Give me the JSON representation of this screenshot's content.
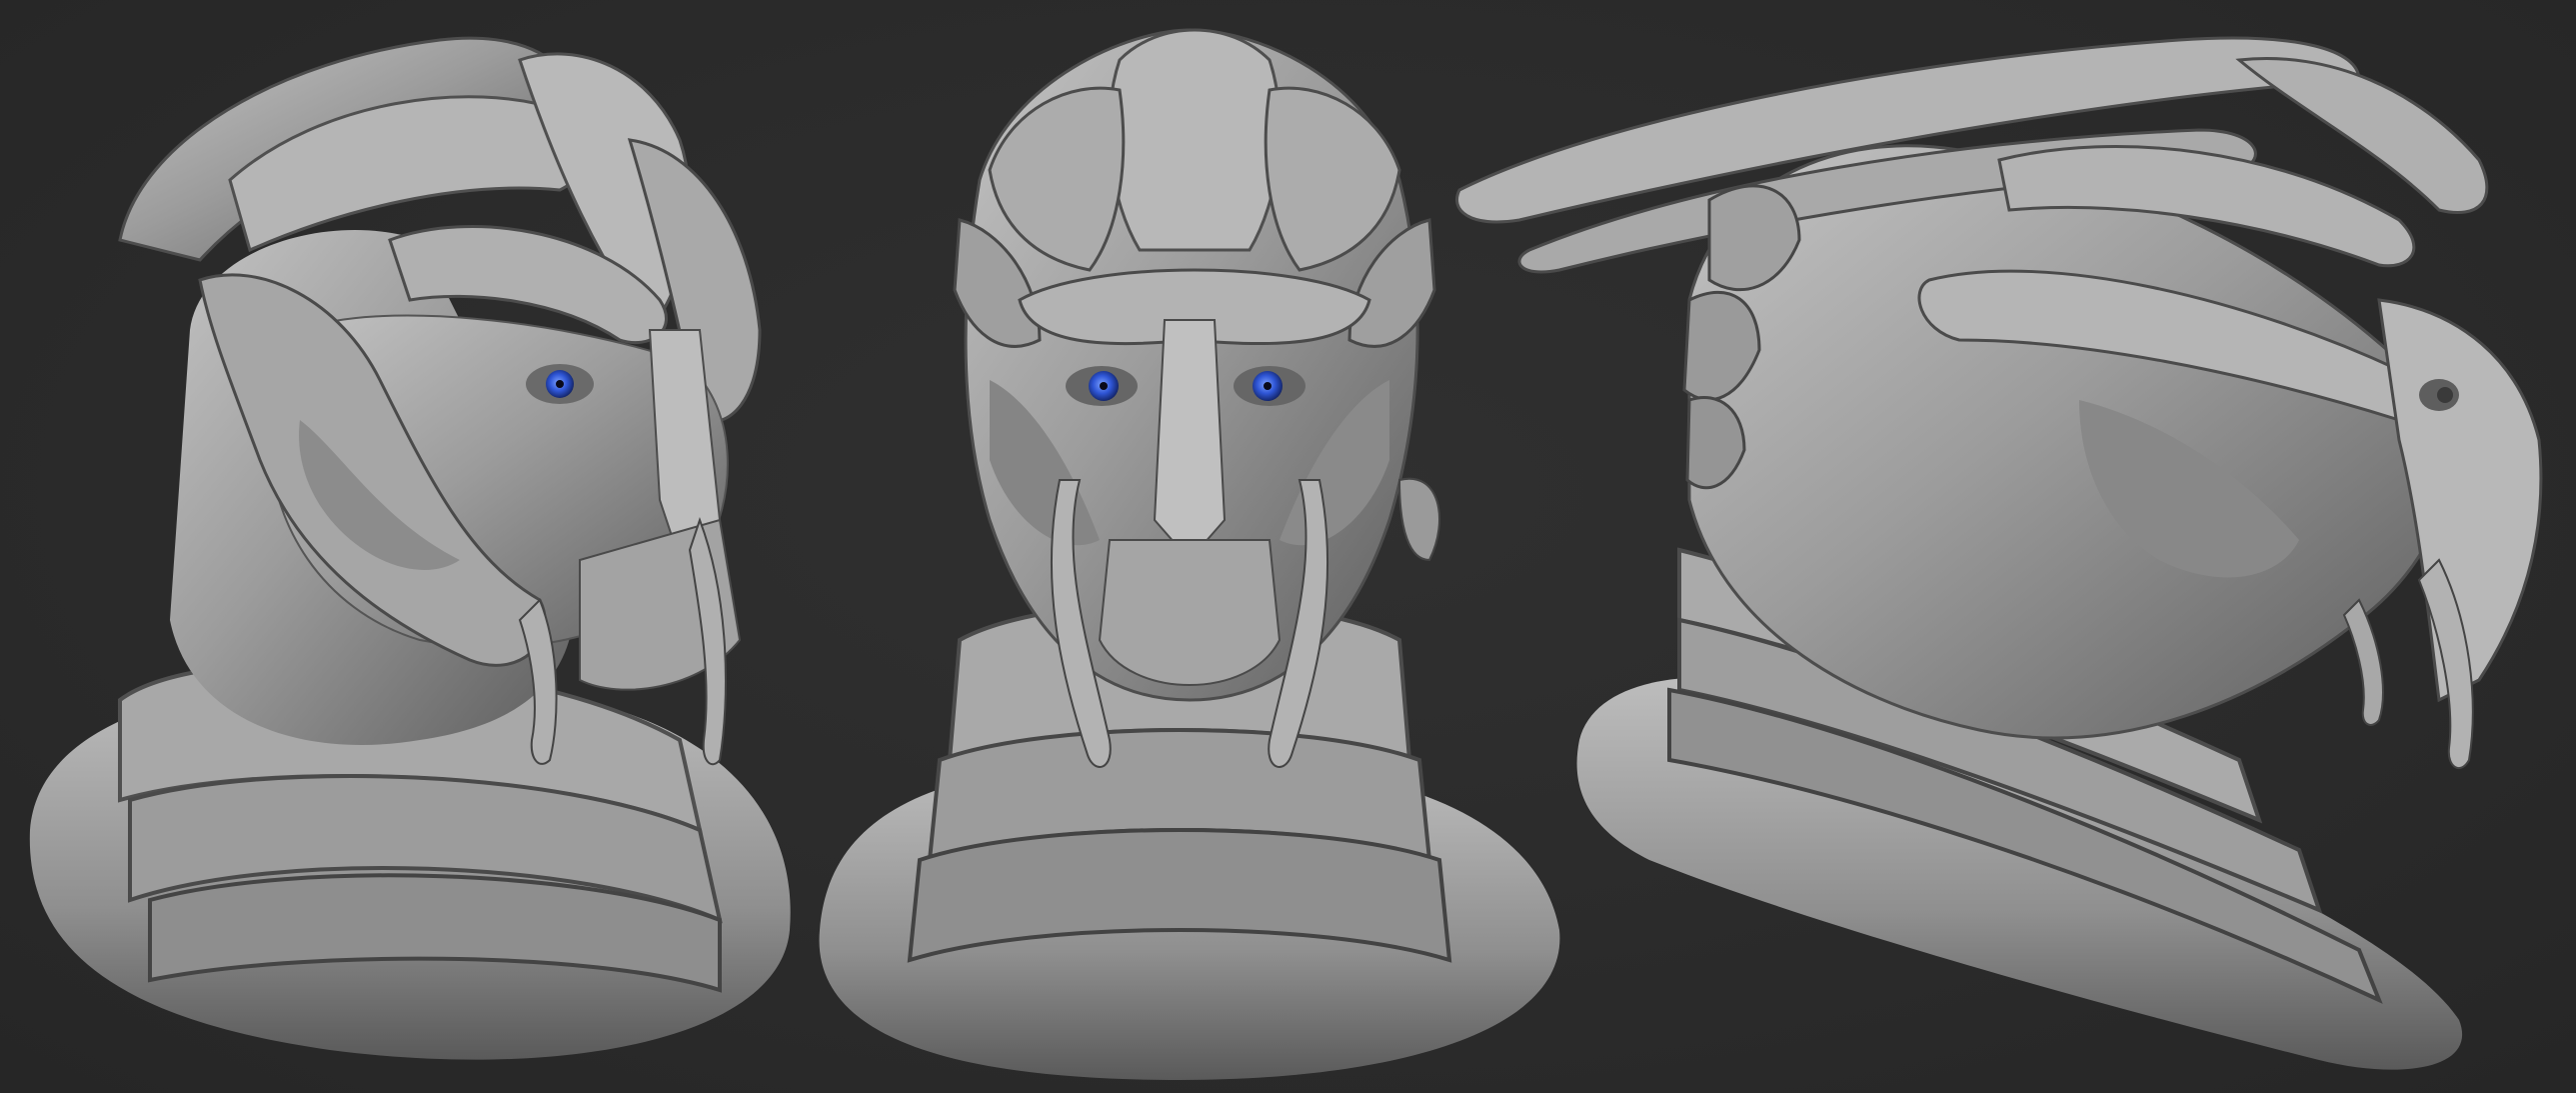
{
  "scene": {
    "background_color": "#2b2b2b",
    "material_color": "#9a9a9a",
    "eye_color": "#2f56d6",
    "views": [
      {
        "name": "three-quarter"
      },
      {
        "name": "front"
      },
      {
        "name": "profile"
      }
    ]
  }
}
